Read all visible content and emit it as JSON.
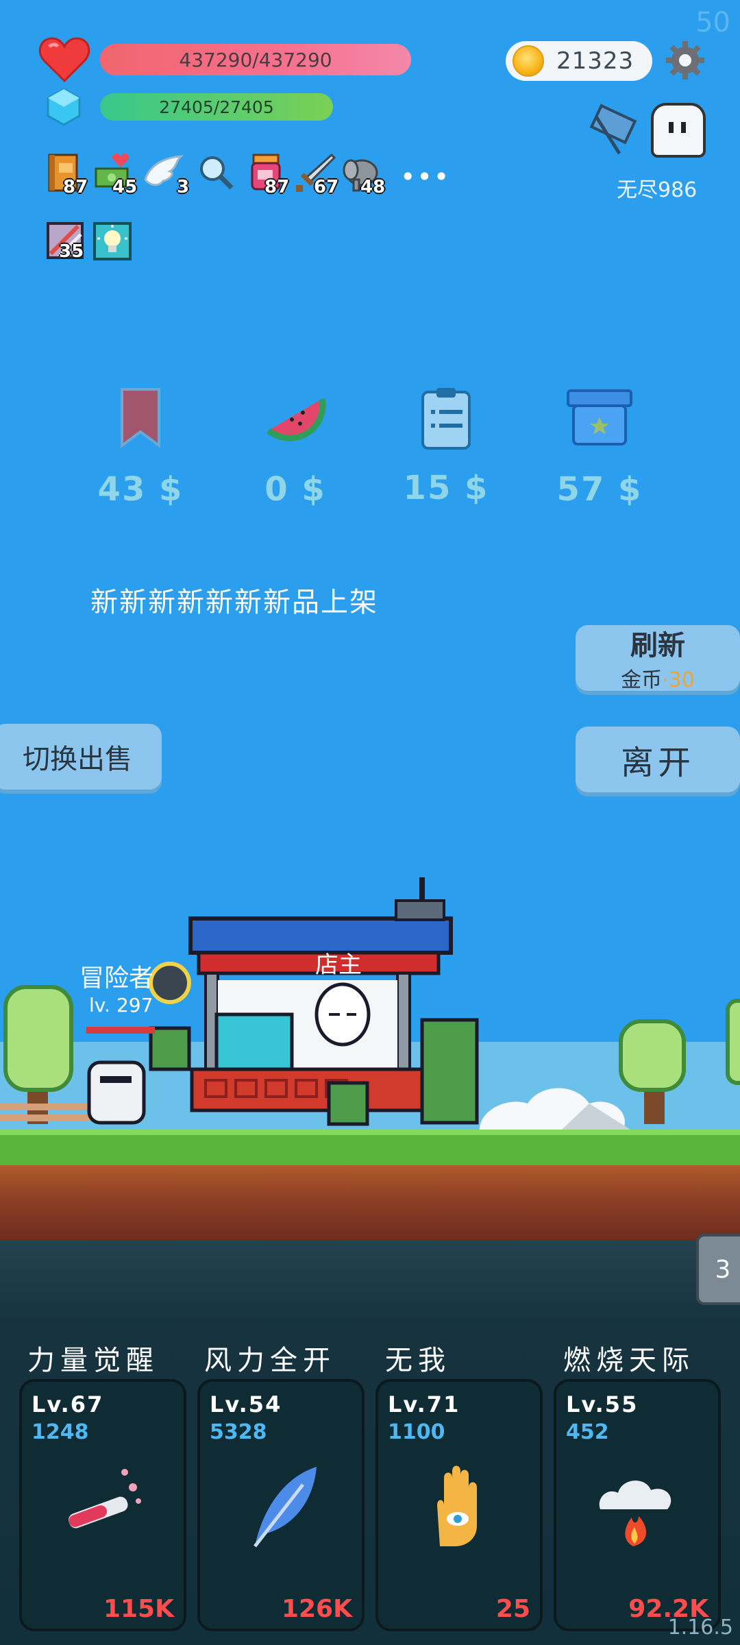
{
  "fps": "50",
  "version": "1.16.5",
  "hp": {
    "text": "437290/437290",
    "fraction": 1.0
  },
  "mp": {
    "text": "27405/27405",
    "fraction": 1.0
  },
  "coins": "21323",
  "mode": "无尽986",
  "items": [
    {
      "icon": "book-icon",
      "count": "87"
    },
    {
      "icon": "cash-heart-icon",
      "count": "45"
    },
    {
      "icon": "wing-icon",
      "count": "3"
    },
    {
      "icon": "magnifier-icon",
      "count": ""
    },
    {
      "icon": "jam-jar-icon",
      "count": "87"
    },
    {
      "icon": "sword-icon",
      "count": "67"
    },
    {
      "icon": "elephant-icon",
      "count": "48"
    },
    {
      "icon": "striped-block-icon",
      "count": "35"
    },
    {
      "icon": "lightbulb-icon",
      "count": ""
    }
  ],
  "more": "•••",
  "goods": [
    {
      "icon": "bookmark-icon",
      "price": "43 $"
    },
    {
      "icon": "watermelon-icon",
      "price": "0 $"
    },
    {
      "icon": "clipboard-icon",
      "price": "15 $"
    },
    {
      "icon": "treasure-box-icon",
      "price": "57 $"
    }
  ],
  "banner": "新新新新新新新品上架",
  "refresh": {
    "label": "刷新",
    "cost_label": "金币",
    "cost_sep": "·",
    "cost_value": "30"
  },
  "leave": "离开",
  "switch_sell": "切换出售",
  "shopkeeper_label": "店主",
  "adventurer": {
    "name": "冒险者",
    "level": "lv. 297"
  },
  "side_tab": "3",
  "skills": [
    {
      "name": "力量觉醒",
      "level": "Lv.67",
      "value": "1248",
      "damage": "115K",
      "icon": "potion-tube-icon"
    },
    {
      "name": "风力全开",
      "level": "Lv.54",
      "value": "5328",
      "damage": "126K",
      "icon": "feather-icon"
    },
    {
      "name": "无我",
      "level": "Lv.71",
      "value": "1100",
      "damage": "25",
      "icon": "hand-eye-icon"
    },
    {
      "name": "燃烧天际",
      "level": "Lv.55",
      "value": "452",
      "damage": "92.2K",
      "icon": "fire-cloud-icon"
    }
  ]
}
